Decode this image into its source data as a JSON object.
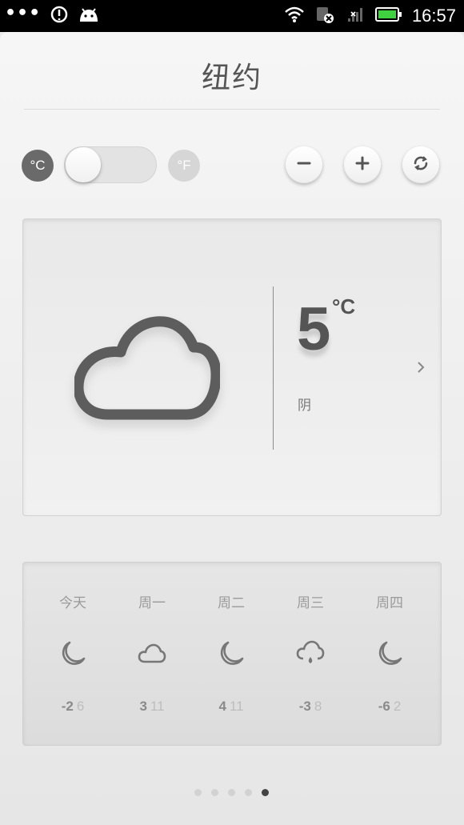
{
  "status_bar": {
    "dots": "•••",
    "time": "16:57"
  },
  "city": "纽约",
  "units": {
    "celsius": "°C",
    "fahrenheit": "°F",
    "selected": "celsius"
  },
  "controls": {
    "remove_icon": "minus-icon",
    "add_icon": "plus-icon",
    "refresh_icon": "refresh-icon"
  },
  "current": {
    "temperature": "5",
    "unit": "°C",
    "condition": "阴",
    "icon": "cloud-icon"
  },
  "forecast": [
    {
      "day": "今天",
      "icon": "moon-icon",
      "low": "-2",
      "high": "6"
    },
    {
      "day": "周一",
      "icon": "cloud-icon",
      "low": "3",
      "high": "11"
    },
    {
      "day": "周二",
      "icon": "moon-icon",
      "low": "4",
      "high": "11"
    },
    {
      "day": "周三",
      "icon": "rain-cloud-icon",
      "low": "-3",
      "high": "8"
    },
    {
      "day": "周四",
      "icon": "moon-icon",
      "low": "-6",
      "high": "2"
    }
  ],
  "pager": {
    "count": 5,
    "active_index": 4
  },
  "colors": {
    "accent": "#555555",
    "background": "#ececec",
    "active_dot": "#444444"
  }
}
